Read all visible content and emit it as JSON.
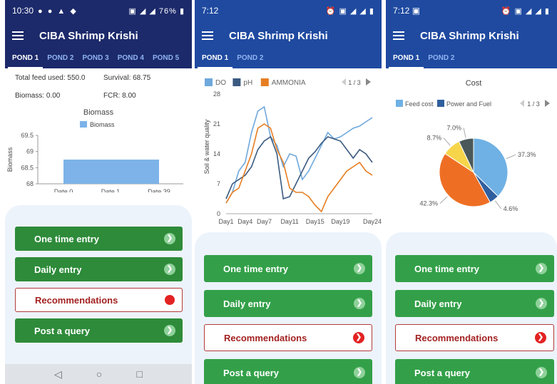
{
  "app": {
    "title": "CIBA Shrimp Krishi"
  },
  "buttons": {
    "one_time": "One time entry",
    "daily": "Daily entry",
    "recommendations": "Recommendations",
    "query": "Post a query"
  },
  "phone1": {
    "status": {
      "time": "10:30",
      "icons": "● ● ▲ ◆",
      "right": "▣ ◢ ◢ 76% ▮"
    },
    "tabs": [
      "POND 1",
      "POND 2",
      "POND 3",
      "POND 4",
      "POND 5"
    ],
    "stats": {
      "feed": "Total feed used: 550.0",
      "survival": "Survival: 68.75",
      "biomass": "Biomass: 0.00",
      "fcr": "FCR: 8.00"
    },
    "chart_title": "Biomass",
    "nav": [
      "◁",
      "○",
      "□"
    ]
  },
  "phone2": {
    "status": {
      "time": "7:12",
      "right": "⏰ ▣ ◢ ◢ ▮"
    },
    "tabs": [
      "POND 1",
      "POND 2"
    ]
  },
  "phone3": {
    "status": {
      "time": "7:12 ▣",
      "right": "⏰ ▣ ◢ ◢ ▮"
    },
    "tabs": [
      "POND 1",
      "POND 2"
    ],
    "chart_title": "Cost"
  },
  "colors": {
    "navy": "#1c2a6b",
    "blue": "#1f4aa0",
    "green": "#2e8b3a",
    "red": "#e32222"
  },
  "chart_data": [
    {
      "type": "bar",
      "title": "Biomass",
      "ylabel": "Biomass",
      "legend": [
        "Biomass"
      ],
      "categories": [
        "Date 0",
        "Date 1",
        "Date 39"
      ],
      "yticks": [
        "69.5",
        "69",
        "68.5",
        "68"
      ],
      "ylim": [
        68,
        69.5
      ],
      "series": [
        {
          "name": "Biomass",
          "color": "#7db3e8",
          "values": [
            68.75
          ]
        }
      ]
    },
    {
      "type": "line",
      "ylabel": "Soil & water quality",
      "pager": "1 / 3",
      "legend_position": "top",
      "ylim": [
        0,
        28
      ],
      "yticks": [
        "28",
        "21",
        "14",
        "7",
        "0"
      ],
      "xticks": [
        "Day1",
        "Day4",
        "Day7",
        "Day11",
        "Day15",
        "Day19",
        "Day24"
      ],
      "x": [
        1,
        2,
        3,
        4,
        5,
        6,
        7,
        8,
        9,
        10,
        11,
        12,
        13,
        14,
        15,
        16,
        17,
        18,
        19,
        20,
        21,
        22,
        23,
        24
      ],
      "series": [
        {
          "name": "DO",
          "color": "#6fa8dc",
          "values": [
            2.5,
            5,
            10,
            12,
            19,
            24,
            25,
            18,
            16,
            11,
            14,
            13.5,
            8,
            10,
            13,
            16,
            19,
            17.5,
            18,
            19,
            20,
            20.5,
            21.5,
            22.5
          ]
        },
        {
          "name": "pH",
          "color": "#3b5a80",
          "values": [
            3.5,
            7,
            8,
            9,
            11,
            15,
            17,
            18,
            14,
            3.5,
            4,
            7,
            10,
            13,
            14.5,
            16.5,
            18,
            17.5,
            17,
            15,
            13,
            15,
            14,
            12
          ]
        },
        {
          "name": "AMMONIA",
          "color": "#e67e22",
          "values": [
            2.5,
            5,
            6,
            10,
            14,
            20,
            21,
            20,
            15,
            12,
            6,
            5,
            5,
            4,
            2,
            0.5,
            4,
            6,
            8,
            10,
            11,
            12,
            10,
            9
          ]
        }
      ]
    },
    {
      "type": "pie",
      "title": "Cost",
      "pager": "1 / 3",
      "legend": [
        "Feed cost",
        "Power and Fuel"
      ],
      "slices": [
        {
          "label": "37.3%",
          "value": 37.3,
          "color": "#6fb1e4"
        },
        {
          "label": "4.6%",
          "value": 4.6,
          "color": "#2f5f9e"
        },
        {
          "label": "42.3%",
          "value": 42.3,
          "color": "#ee6f24"
        },
        {
          "label": "8.7%",
          "value": 8.7,
          "color": "#f6d54a"
        },
        {
          "label": "7.0%",
          "value": 7.0,
          "color": "#4a5859"
        }
      ]
    }
  ]
}
